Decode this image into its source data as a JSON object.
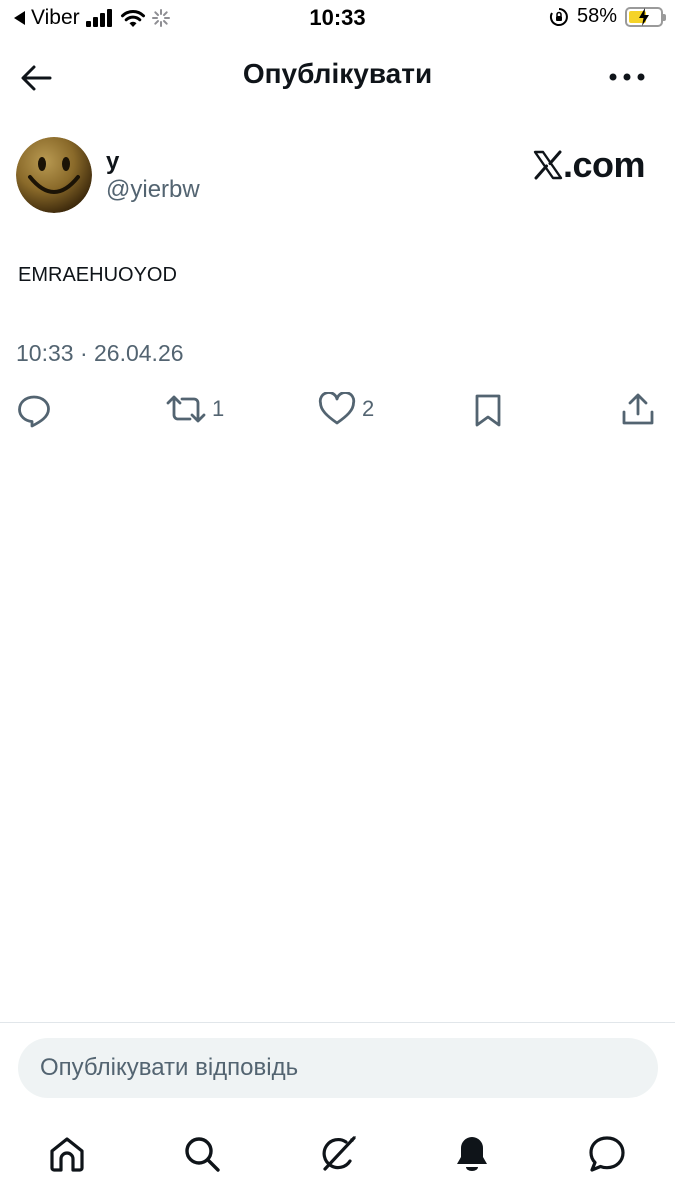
{
  "status_bar": {
    "carrier": "Viber",
    "time": "10:33",
    "battery": "58%",
    "battery_level": 0.58
  },
  "header": {
    "title": "Опублікувати"
  },
  "post": {
    "author_name": "y",
    "author_handle": "@yierbw",
    "brand": ".com",
    "text": "EMRAEHUOYOD",
    "meta": "10:33 · 26.04.26",
    "actions": {
      "retweet_count": "1",
      "like_count": "2"
    }
  },
  "reply": {
    "placeholder": "Опублікувати відповідь"
  },
  "tabs": [
    "home-icon",
    "search-icon",
    "grok-icon",
    "notifications-icon",
    "messages-icon"
  ],
  "colors": {
    "text": "#0f1419",
    "secondary": "#536471",
    "input_bg": "#eff3f4"
  }
}
